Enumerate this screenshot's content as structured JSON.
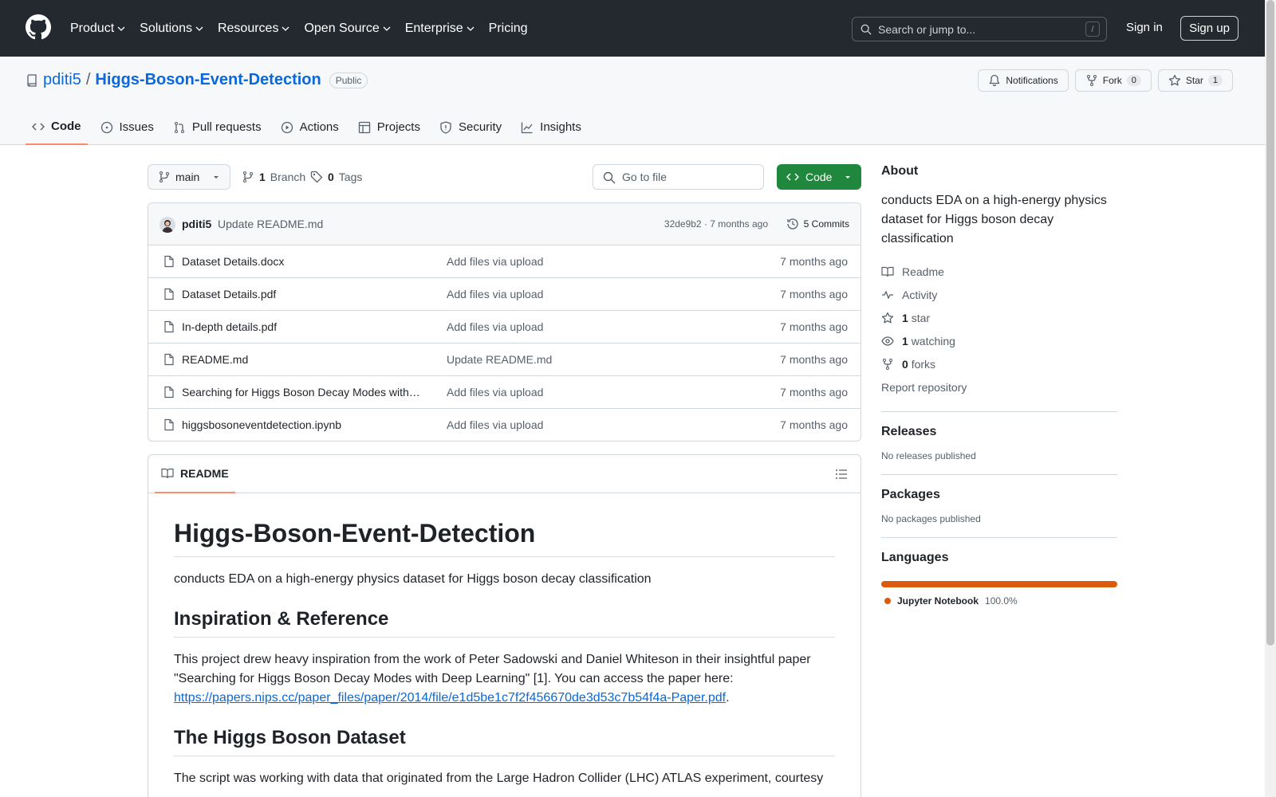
{
  "header": {
    "nav": [
      "Product",
      "Solutions",
      "Resources",
      "Open Source",
      "Enterprise",
      "Pricing"
    ],
    "search_placeholder": "Search or jump to...",
    "search_shortcut": "/",
    "sign_in": "Sign in",
    "sign_up": "Sign up"
  },
  "repo": {
    "owner": "pditi5",
    "separator": "/",
    "name": "Higgs-Boson-Event-Detection",
    "visibility": "Public",
    "notifications": "Notifications",
    "fork_label": "Fork",
    "fork_count": "0",
    "star_label": "Star",
    "star_count": "1"
  },
  "tabs": [
    "Code",
    "Issues",
    "Pull requests",
    "Actions",
    "Projects",
    "Security",
    "Insights"
  ],
  "toolbar": {
    "branch": "main",
    "branch_count": "1",
    "branch_label": "Branch",
    "tag_count": "0",
    "tag_label": "Tags",
    "goto_placeholder": "Go to file",
    "code_button": "Code"
  },
  "commit": {
    "author": "pditi5",
    "message": "Update README.md",
    "meta": "32de9b2 · 7 months ago",
    "commits": "5 Commits"
  },
  "files": [
    {
      "name": "Dataset Details.docx",
      "message": "Add files via upload",
      "date": "7 months ago"
    },
    {
      "name": "Dataset Details.pdf",
      "message": "Add files via upload",
      "date": "7 months ago"
    },
    {
      "name": "In-depth details.pdf",
      "message": "Add files via upload",
      "date": "7 months ago"
    },
    {
      "name": "README.md",
      "message": "Update README.md",
      "date": "7 months ago"
    },
    {
      "name": "Searching for Higgs Boson Decay Modes with…",
      "message": "Add files via upload",
      "date": "7 months ago"
    },
    {
      "name": "higgsbosoneventdetection.ipynb",
      "message": "Add files via upload",
      "date": "7 months ago"
    }
  ],
  "readme": {
    "tab_label": "README",
    "title": "Higgs-Boson-Event-Detection",
    "intro": "conducts EDA on a high-energy physics dataset for Higgs boson decay classification",
    "h2_inspiration": "Inspiration & Reference",
    "inspiration_text": "This project drew heavy inspiration from the work of Peter Sadowski and Daniel Whiteson in their insightful paper \"Searching for Higgs Boson Decay Modes with Deep Learning\" [1]. You can access the paper here:",
    "paper_link": "https://papers.nips.cc/paper_files/paper/2014/file/e1d5be1c7f2f456670de3d53c7b54f4a-Paper.pdf",
    "link_suffix": ".",
    "h2_dataset": "The Higgs Boson Dataset",
    "dataset_text": "The script was working with data that originated from the Large Hadron Collider (LHC) ATLAS experiment, courtesy"
  },
  "sidebar": {
    "about_title": "About",
    "about_desc": "conducts EDA on a high-energy physics dataset for Higgs boson decay classification",
    "readme": "Readme",
    "activity": "Activity",
    "stars_count": "1",
    "stars_label": "star",
    "watching_count": "1",
    "watching_label": "watching",
    "forks_count": "0",
    "forks_label": "forks",
    "report": "Report repository",
    "releases_title": "Releases",
    "releases_text": "No releases published",
    "packages_title": "Packages",
    "packages_text": "No packages published",
    "languages_title": "Languages",
    "language_name": "Jupyter Notebook",
    "language_pct": "100.0%",
    "language_color": "#da5b0b",
    "language_share": 100
  }
}
